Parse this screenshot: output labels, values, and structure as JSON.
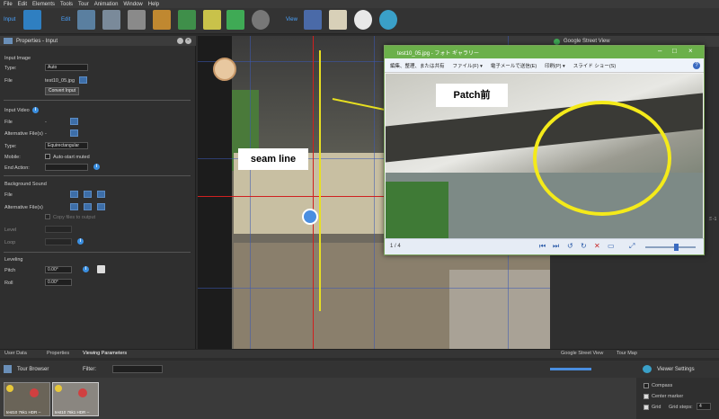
{
  "menu": [
    "File",
    "Edit",
    "Elements",
    "Tools",
    "Tour",
    "Animation",
    "Window",
    "Help"
  ],
  "toolbar": {
    "input_label": "Input",
    "edit_label": "Edit",
    "view_label": "View"
  },
  "left_panel": {
    "title": "Properties - Input",
    "input_image": "Input Image",
    "type_label": "Type:",
    "type_value": "Auto",
    "file_label": "File",
    "file_value": "test10_05.jpg",
    "convert_button": "Convert Input",
    "input_video": "Input Video",
    "video_file_label": "File",
    "video_file_value": "-",
    "alt_files_label": "Alternative File(s)",
    "alt_files_value": "-",
    "video_type_label": "Type:",
    "video_type_value": "Equirectangular",
    "mobile_label": "Mobile:",
    "autostart_label": "Auto-start muted",
    "end_action_label": "End Action:",
    "background_sound": "Background Sound",
    "sound_file_label": "File",
    "sound_alt_label": "Alternative File(s)",
    "copy_files_label": "Copy files to output",
    "level_label": "Level",
    "loop_label": "Loop",
    "leveling": "Leveling",
    "pitch_label": "Pitch",
    "pitch_value": "0.00°",
    "roll_label": "Roll",
    "roll_value": "0.00°"
  },
  "viewer": {
    "seam_label": "seam line",
    "patch_label": "Patch前"
  },
  "photo_window": {
    "title": "test10_05.jpg - フォト ギャラリー",
    "menu": [
      "編集、整理、または共有",
      "ファイル(F) ▾",
      "電子メールで送信(E)",
      "印刷(P) ▾",
      "スライド ショー(S)"
    ],
    "counter": "1 / 4"
  },
  "right_panel": {
    "title": "Google Street View",
    "peek_label": "ミ-1"
  },
  "bottom_tabs": [
    "User Data",
    "Properties",
    "Viewing Parameters"
  ],
  "right_bottom_tabs": [
    "Google Street View",
    "Tour Map"
  ],
  "tour_browser": {
    "title": "Tour Browser",
    "filter_label": "Filter:"
  },
  "thumbnails": [
    {
      "caption": "test10 76k1 HDR --"
    },
    {
      "caption": "test10 76k1 HDR --"
    }
  ],
  "viewer_settings": {
    "title": "Viewer Settings",
    "compass_label": "Compass",
    "center_marker_label": "Center marker",
    "grid_label": "Grid",
    "grid_steps_label": "Grid steps:",
    "grid_steps_value": "4"
  },
  "colors": {
    "accent": "#3b8fe0",
    "annotation_line": "#e8e020",
    "panel_bg": "#2f2f2f",
    "win_green": "#5fa83a"
  }
}
